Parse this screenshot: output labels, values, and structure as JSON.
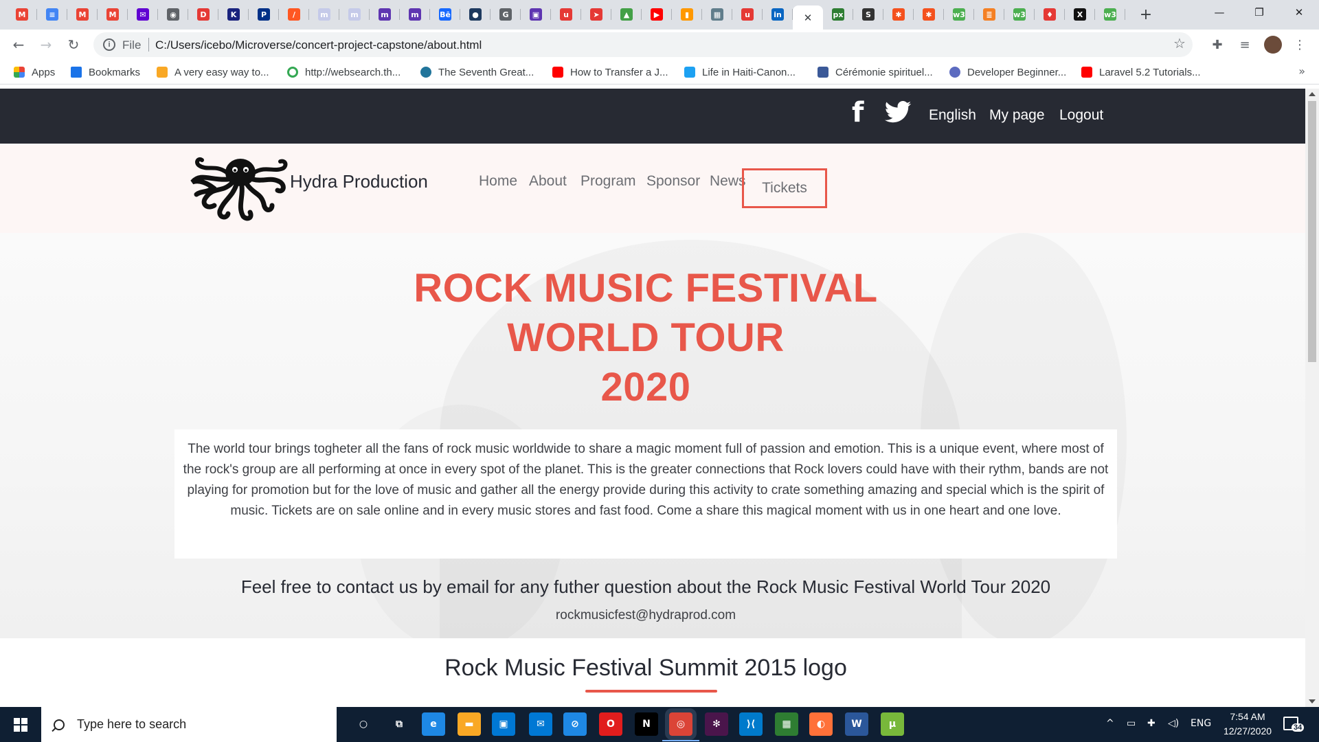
{
  "browser": {
    "tab_favicons": [
      {
        "icon": "gmail-icon",
        "color": "#ea4335",
        "glyph": "M"
      },
      {
        "icon": "docs-icon",
        "color": "#4285f4",
        "glyph": "≡"
      },
      {
        "icon": "gmail-icon",
        "color": "#ea4335",
        "glyph": "M"
      },
      {
        "icon": "gmail-icon",
        "color": "#ea4335",
        "glyph": "M"
      },
      {
        "icon": "yahoo-mail-icon",
        "color": "#6001d2",
        "glyph": "✉"
      },
      {
        "icon": "globe-icon",
        "color": "#5f6368",
        "glyph": "◉"
      },
      {
        "icon": "d-icon",
        "color": "#e53935",
        "glyph": "D"
      },
      {
        "icon": "k-icon",
        "color": "#1a237e",
        "glyph": "K"
      },
      {
        "icon": "paypal-icon",
        "color": "#003087",
        "glyph": "P"
      },
      {
        "icon": "orange-icon",
        "color": "#ff5722",
        "glyph": "/"
      },
      {
        "icon": "mm-icon",
        "color": "#c5cae9",
        "glyph": "m"
      },
      {
        "icon": "mm-icon",
        "color": "#c5cae9",
        "glyph": "m"
      },
      {
        "icon": "purple-icon",
        "color": "#5e35b1",
        "glyph": "m"
      },
      {
        "icon": "purple-icon",
        "color": "#5e35b1",
        "glyph": "m"
      },
      {
        "icon": "behance-icon",
        "color": "#1769ff",
        "glyph": "Bē"
      },
      {
        "icon": "head-icon",
        "color": "#1e3a5f",
        "glyph": "●"
      },
      {
        "icon": "reload-g-icon",
        "color": "#5f6368",
        "glyph": "G"
      },
      {
        "icon": "purple-icon",
        "color": "#5e35b1",
        "glyph": "▣"
      },
      {
        "icon": "u-icon",
        "color": "#e53935",
        "glyph": "u"
      },
      {
        "icon": "paper-plane-icon",
        "color": "#e53935",
        "glyph": "➤"
      },
      {
        "icon": "chart-icon",
        "color": "#43a047",
        "glyph": "▲"
      },
      {
        "icon": "youtube-icon",
        "color": "#ff0000",
        "glyph": "▶"
      },
      {
        "icon": "bookmark-icon",
        "color": "#ff9800",
        "glyph": "▮"
      },
      {
        "icon": "image-icon",
        "color": "#607d8b",
        "glyph": "▦"
      },
      {
        "icon": "u-icon",
        "color": "#e53935",
        "glyph": "u"
      },
      {
        "icon": "linkedin-icon",
        "color": "#0a66c2",
        "glyph": "in"
      },
      {
        "icon": "close-icon",
        "color": "#ffffff",
        "glyph": "✕",
        "active": true
      },
      {
        "icon": "500px-icon",
        "color": "#2e7d32",
        "glyph": "px"
      },
      {
        "icon": "s-icon",
        "color": "#333333",
        "glyph": "S"
      },
      {
        "icon": "asterisk-icon",
        "color": "#f4511e",
        "glyph": "✱"
      },
      {
        "icon": "asterisk-icon",
        "color": "#f4511e",
        "glyph": "✱"
      },
      {
        "icon": "w3-icon",
        "color": "#4caf50",
        "glyph": "w3"
      },
      {
        "icon": "stack-icon",
        "color": "#f48024",
        "glyph": "≣"
      },
      {
        "icon": "w3-icon",
        "color": "#4caf50",
        "glyph": "w3"
      },
      {
        "icon": "flame-icon",
        "color": "#e53935",
        "glyph": "♦"
      },
      {
        "icon": "x-icon",
        "color": "#111111",
        "glyph": "X"
      },
      {
        "icon": "w3-icon",
        "color": "#4caf50",
        "glyph": "w3"
      }
    ],
    "new_tab": "+",
    "controls": {
      "minimize": "—",
      "maximize": "❐",
      "close": "✕"
    },
    "address": {
      "scheme": "File",
      "url": "C:/Users/icebo/Microverse/concert-project-capstone/about.html"
    },
    "bookmarks": [
      {
        "label": "Apps",
        "color": "#ea4335"
      },
      {
        "label": "Bookmarks",
        "color": "#1a73e8"
      },
      {
        "label": "A very easy way to...",
        "color": "#f9a825"
      },
      {
        "label": "http://websearch.th...",
        "color": "#34a853"
      },
      {
        "label": "The Seventh Great...",
        "color": "#21759b"
      },
      {
        "label": "How to Transfer a J...",
        "color": "#ff0000"
      },
      {
        "label": "Life in Haiti-Canon...",
        "color": "#1da1f2"
      },
      {
        "label": "Cérémonie spirituel...",
        "color": "#3b5998"
      },
      {
        "label": "Developer Beginner...",
        "color": "#5c6bc0"
      },
      {
        "label": "Laravel 5.2 Tutorials...",
        "color": "#ff0000"
      }
    ],
    "bookmarks_more": "»"
  },
  "site": {
    "topbar": {
      "facebook": "f",
      "links": [
        "English",
        "My page",
        "Logout"
      ]
    },
    "brand": "Hydra Production",
    "nav": [
      "Home",
      "About",
      "Program",
      "Sponsor",
      "News"
    ],
    "tickets": "Tickets",
    "hero": {
      "title_lines": [
        "ROCK MUSIC FESTIVAL",
        "WORLD TOUR",
        "2020"
      ],
      "text": "The world tour brings togheter all the fans of rock music worldwide to share a magic moment full of passion and emotion. This is a unique event, where most of the rock's group are all performing at once in every spot of the planet. This is the greater connections that Rock lovers could have with their rythm, bands are not playing for promotion but for the love of music and gather all the energy provide during this activity to crate something amazing and special which is the spirit of music. Tickets are on sale online and in every music stores and fast food. Come a share this magical moment with us in one heart and one love.",
      "contact_heading": "Feel free to contact us by email for any futher question about the Rock Music Festival World Tour 2020",
      "email": "rockmusicfest@hydraprod.com"
    },
    "section_title": "Rock Music Festival Summit 2015 logo",
    "accent_color": "#e8574a"
  },
  "taskbar": {
    "search_placeholder": "Type here to search",
    "apps": [
      {
        "icon": "cortana-icon",
        "color": "transparent",
        "glyph": "○"
      },
      {
        "icon": "task-view-icon",
        "color": "transparent",
        "glyph": "⧉"
      },
      {
        "icon": "edge-icon",
        "color": "#1e88e5",
        "glyph": "e"
      },
      {
        "icon": "file-explorer-icon",
        "color": "#f9a825",
        "glyph": "▬"
      },
      {
        "icon": "store-icon",
        "color": "#0078d4",
        "glyph": "▣"
      },
      {
        "icon": "mail-icon",
        "color": "#0078d4",
        "glyph": "✉"
      },
      {
        "icon": "safari-icon",
        "color": "#1e88e5",
        "glyph": "⊘"
      },
      {
        "icon": "opera-icon",
        "color": "#e11d1d",
        "glyph": "O"
      },
      {
        "icon": "netflix-icon",
        "color": "#000000",
        "glyph": "N"
      },
      {
        "icon": "chrome-icon",
        "color": "#db4437",
        "glyph": "◎",
        "running": true
      },
      {
        "icon": "slack-icon",
        "color": "#4a154b",
        "glyph": "✻"
      },
      {
        "icon": "vscode-icon",
        "color": "#007acc",
        "glyph": "⟩⟨"
      },
      {
        "icon": "photo-icon",
        "color": "#2e7d32",
        "glyph": "▦"
      },
      {
        "icon": "firefox-icon",
        "color": "#ff7139",
        "glyph": "◐"
      },
      {
        "icon": "word-icon",
        "color": "#2b579a",
        "glyph": "W"
      },
      {
        "icon": "utorrent-icon",
        "color": "#78b83b",
        "glyph": "μ"
      }
    ],
    "tray": {
      "chevron": "^",
      "language": "ENG"
    },
    "time": "7:54 AM",
    "date": "12/27/2020",
    "notifications": "34"
  }
}
